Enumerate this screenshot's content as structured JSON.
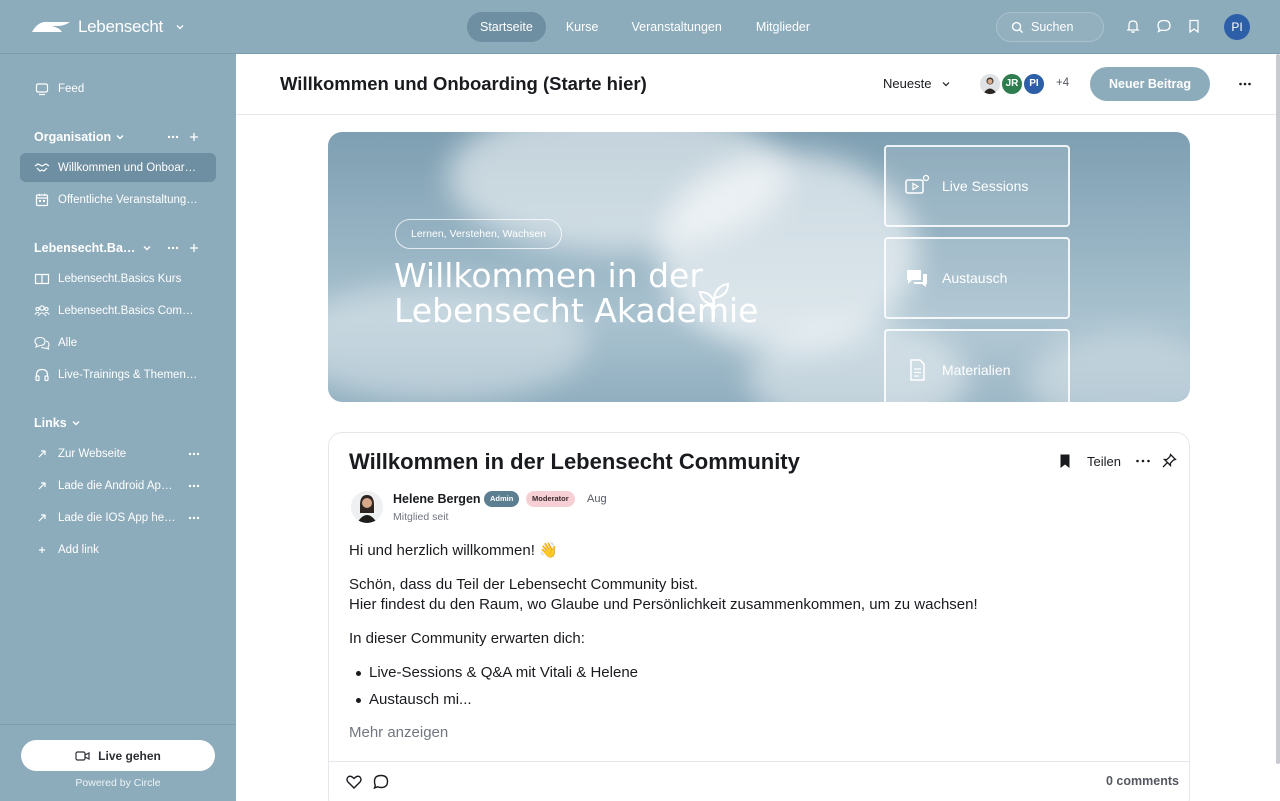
{
  "brand": {
    "name": "Lebensecht"
  },
  "nav": {
    "items": [
      "Startseite",
      "Kurse",
      "Veranstaltungen",
      "Mitglieder"
    ],
    "active": "Startseite"
  },
  "search": {
    "placeholder": "Suchen"
  },
  "user": {
    "initials": "PI"
  },
  "sidebar": {
    "feed": "Feed",
    "groups": [
      {
        "title": "Organisation",
        "items": [
          "Willkommen und Onboarding (Starte hier)",
          "Öffentliche Veranstaltungen"
        ]
      },
      {
        "title": "Lebensecht.Basics",
        "items": [
          "Lebensecht.Basics Kurs",
          "Lebensecht.Basics Community",
          "Alle",
          "Live-Trainings & Themenabende"
        ]
      },
      {
        "title": "Links",
        "items": [
          "Zur Webseite",
          "Lade die Android App herunter",
          "Lade die IOS App herunter"
        ]
      }
    ],
    "add_link": "Add link",
    "live_button": "Live gehen",
    "powered": "Powered by Circle"
  },
  "header": {
    "title": "Willkommen und Onboarding (Starte hier)",
    "sort": "Neueste",
    "members": [
      {
        "initials": "JR",
        "color": "#2e7d4f"
      },
      {
        "initials": "PI",
        "color": "#2d5fa8"
      }
    ],
    "member_count": "+4",
    "new_post": "Neuer Beitrag"
  },
  "banner": {
    "tagline": "Lernen, Verstehen, Wachsen",
    "headline_1": "Willkommen in der",
    "headline_2": "Lebensecht Akademie",
    "cards": [
      "Live Sessions",
      "Austausch",
      "Materialien"
    ]
  },
  "post": {
    "title": "Willkommen in der Lebensecht Community",
    "share": "Teilen",
    "author": "Helene Bergen",
    "badge_admin": "Admin",
    "badge_mod": "Moderator",
    "date": "Aug",
    "member_since": "Mitglied seit",
    "greeting": "Hi und herzlich willkommen! 👋",
    "p1": "Schön, dass du Teil der Lebensecht Community bist.",
    "p2": "Hier findest du den Raum, wo Glaube und Persönlichkeit zusammenkommen, um zu wachsen!",
    "p3": "In dieser Community erwarten dich:",
    "bullets": [
      "Live-Sessions & Q&A mit Vitali & Helene",
      "Austausch mi..."
    ],
    "more": "Mehr anzeigen",
    "comments": "0 comments"
  },
  "colors": {
    "sidebar": "#8cabbb",
    "active": "#6e8fa1",
    "accent_badge": "#f7d0d6"
  }
}
